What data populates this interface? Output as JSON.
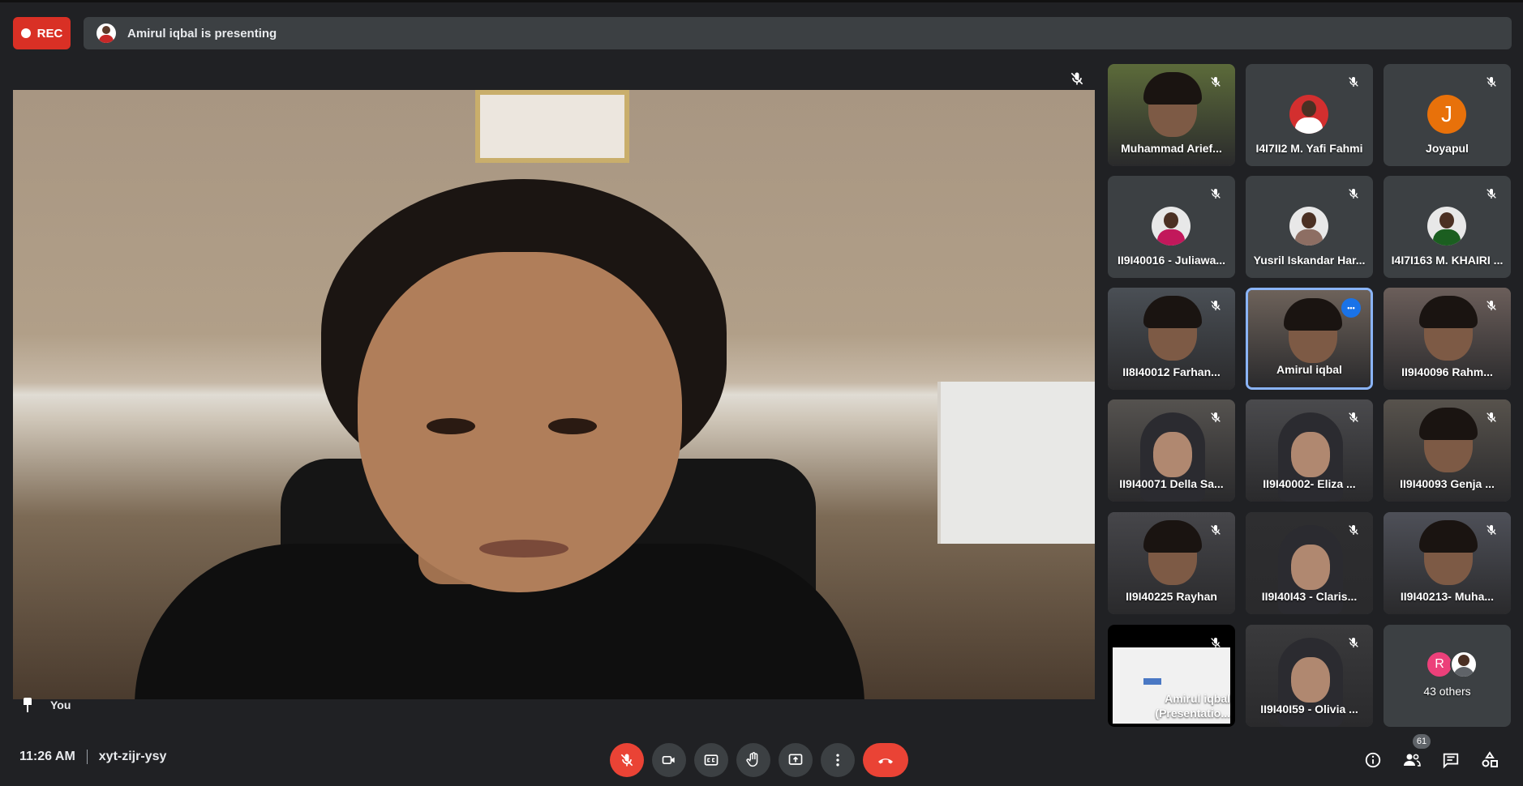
{
  "recording": {
    "label": "REC"
  },
  "presenting_banner": {
    "text": "Amirul iqbal is presenting"
  },
  "self_view": {
    "label": "You"
  },
  "participants": [
    {
      "name": "Muhammad Arief...",
      "type": "video"
    },
    {
      "name": "I4I7II2 M. Yafi Fahmi",
      "type": "avatar"
    },
    {
      "name": "Joyapul",
      "type": "letter",
      "initial": "J"
    },
    {
      "name": "II9I40016 - Juliawa...",
      "type": "avatar"
    },
    {
      "name": "Yusril Iskandar Har...",
      "type": "avatar"
    },
    {
      "name": "I4I7I163 M. KHAIRI ...",
      "type": "avatar"
    },
    {
      "name": "II8I40012 Farhan...",
      "type": "video"
    },
    {
      "name": "Amirul iqbal",
      "type": "video",
      "speaking": true
    },
    {
      "name": "II9I40096 Rahm...",
      "type": "video"
    },
    {
      "name": "II9I40071 Della Sa...",
      "type": "video"
    },
    {
      "name": "II9I40002- Eliza ...",
      "type": "video"
    },
    {
      "name": "II9I40093 Genja ...",
      "type": "video"
    },
    {
      "name": "II9I40225 Rayhan",
      "type": "video"
    },
    {
      "name": "II9I40I43 - Claris...",
      "type": "video"
    },
    {
      "name": "II9I40213- Muha...",
      "type": "video"
    },
    {
      "name": "Amirul iqbal (Presentatio...",
      "type": "presentation"
    },
    {
      "name": "II9I40I59 - Olivia ...",
      "type": "video"
    }
  ],
  "others": {
    "label": "43 others",
    "initial": "R"
  },
  "meeting": {
    "time": "11:26 AM",
    "code": "xyt-zijr-ysy"
  },
  "people_count": "61",
  "controls": [
    "microphone-muted",
    "camera",
    "captions",
    "raise-hand",
    "present",
    "more-options",
    "leave-call"
  ],
  "colors": {
    "accent": "#1a73e8",
    "danger": "#ea4335",
    "speaking_border": "#8ab4f8"
  }
}
